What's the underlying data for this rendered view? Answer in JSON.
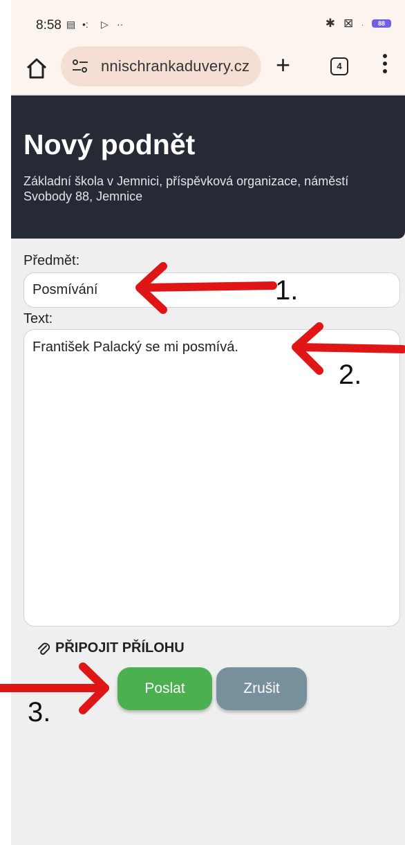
{
  "status_bar": {
    "time": "8:58",
    "battery": "88"
  },
  "browser": {
    "url": "nnischrankaduvery.cz",
    "tab_count": "4"
  },
  "header": {
    "title": "Nový podnět",
    "subtitle": "Základní škola v Jemnici, příspěvková organizace, náměstí Svobody 88, Jemnice"
  },
  "form": {
    "subject_label": "Předmět:",
    "subject_value": "Posmívání",
    "text_label": "Text:",
    "text_value": "František Palacký se mi posmívá.",
    "attach_label": "PŘIPOJIT PŘÍLOHU",
    "send_label": "Poslat",
    "cancel_label": "Zrušit"
  },
  "annotations": {
    "marker_1": "1.",
    "marker_2": "2.",
    "marker_3": "3.",
    "arrow_color": "#e01616"
  },
  "colors": {
    "header_bg": "#252a35",
    "send_button": "#4caf50",
    "cancel_button": "#78909c"
  }
}
